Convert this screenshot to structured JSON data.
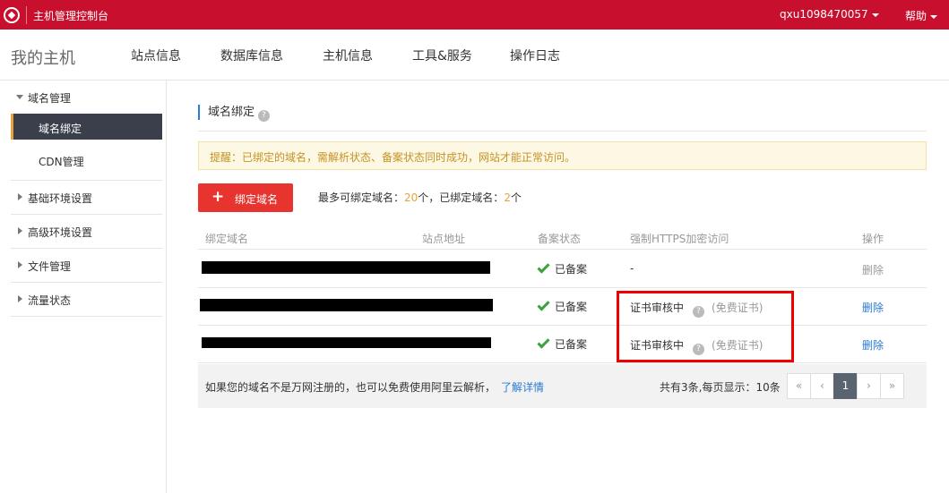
{
  "topbar": {
    "app_title": "主机管理控制台",
    "user": "qxu1098470057",
    "help": "帮助"
  },
  "nav": {
    "title": "我的主机",
    "items": [
      "站点信息",
      "数据库信息",
      "主机信息",
      "工具&服务",
      "操作日志"
    ]
  },
  "sidebar": {
    "domain_mgmt": "域名管理",
    "domain_bind": "域名绑定",
    "cdn": "CDN管理",
    "basic_env": "基础环境设置",
    "advanced_env": "高级环境设置",
    "file_mgmt": "文件管理",
    "traffic": "流量状态"
  },
  "main": {
    "section_title": "域名绑定",
    "help_icon": "?",
    "notice": "提醒：已绑定的域名，需解析状态、备案状态同时成功，网站才能正常访问。",
    "bind_button": "绑定域名",
    "bind_icon": "+",
    "limit_prefix": "最多可绑定域名：",
    "limit_max": "20",
    "limit_mid": "个，已绑定域名：",
    "limit_bound": "2",
    "limit_suffix": "个"
  },
  "table": {
    "headers": [
      "绑定域名",
      "站点地址",
      "备案状态",
      "强制HTTPS加密访问",
      "操作"
    ],
    "rows": [
      {
        "status": "已备案",
        "https": "-",
        "https_note": "",
        "op": "删除"
      },
      {
        "status": "已备案",
        "https": "证书审核中",
        "https_note": "(免费证书)",
        "op": "删除"
      },
      {
        "status": "已备案",
        "https": "证书审核中",
        "https_note": "(免费证书)",
        "op": "删除"
      }
    ]
  },
  "footer": {
    "note": "如果您的域名不是万网注册的，也可以免费使用阿里云解析，",
    "link": "了解详情",
    "paging_info": "共有3条,每页显示：10条",
    "pager": [
      "«",
      "‹",
      "1",
      "›",
      "»"
    ]
  },
  "colors": {
    "brand_red": "#c8102e",
    "button_red": "#e8342f",
    "link_blue": "#2a7bd4",
    "check_green": "#3ba33b",
    "highlight_red": "#e00000"
  }
}
